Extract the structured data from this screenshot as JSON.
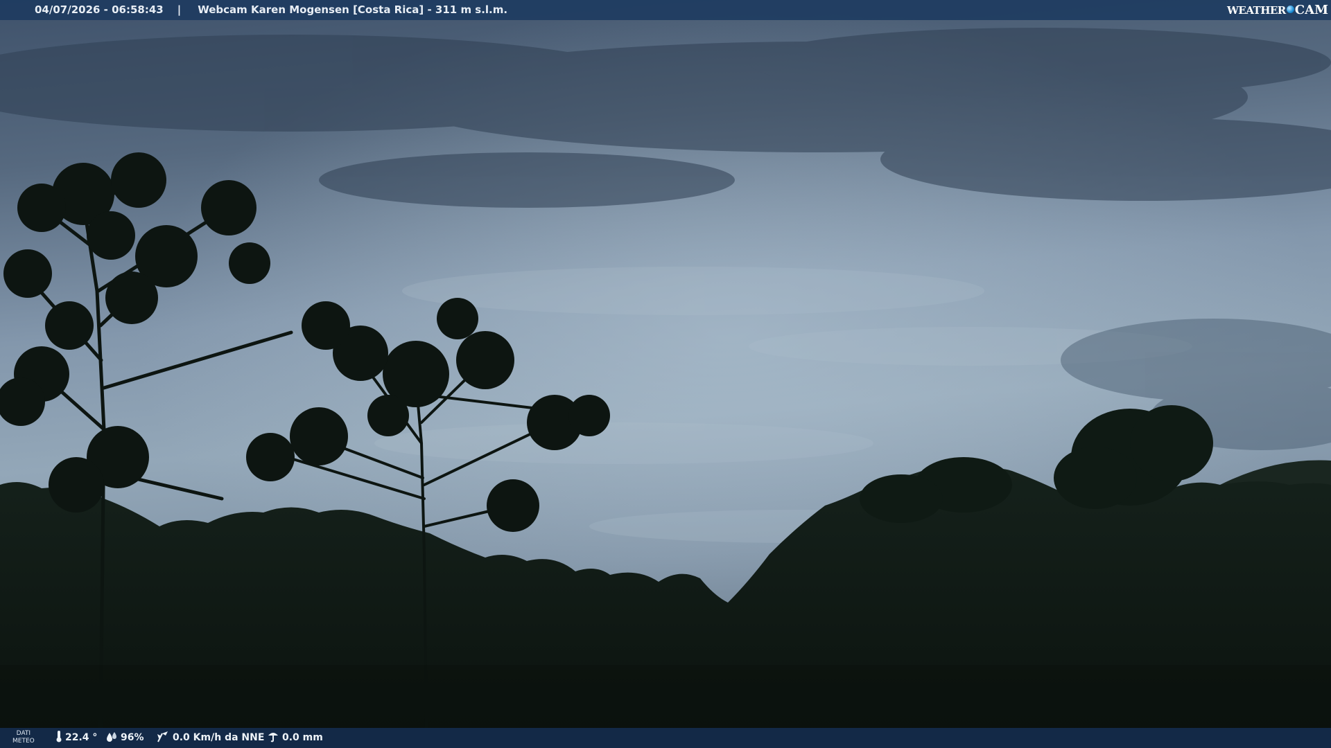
{
  "header": {
    "timestamp": "04/07/2026 - 06:58:43",
    "separator": "|",
    "title": "Webcam Karen Mogensen [Costa Rica]  - 311 m s.l.m."
  },
  "logo": {
    "text_weather": "WEATHER",
    "text_cam": "CAM"
  },
  "footer": {
    "dati_line1": "DATI",
    "dati_line2": "METEO",
    "temperature": "22.4 °",
    "humidity": "96%",
    "wind": "0.0 Km/h da NNE",
    "rain": "0.0 mm"
  },
  "icons": [
    "thermometer-icon",
    "humidity-icon",
    "wind-icon",
    "rain-gauge-icon"
  ],
  "colors": {
    "bar": "#1c3a60",
    "sky_top": "#3b4e66",
    "sky_mid": "#8ea4b8",
    "foliage": "#0e1712"
  }
}
